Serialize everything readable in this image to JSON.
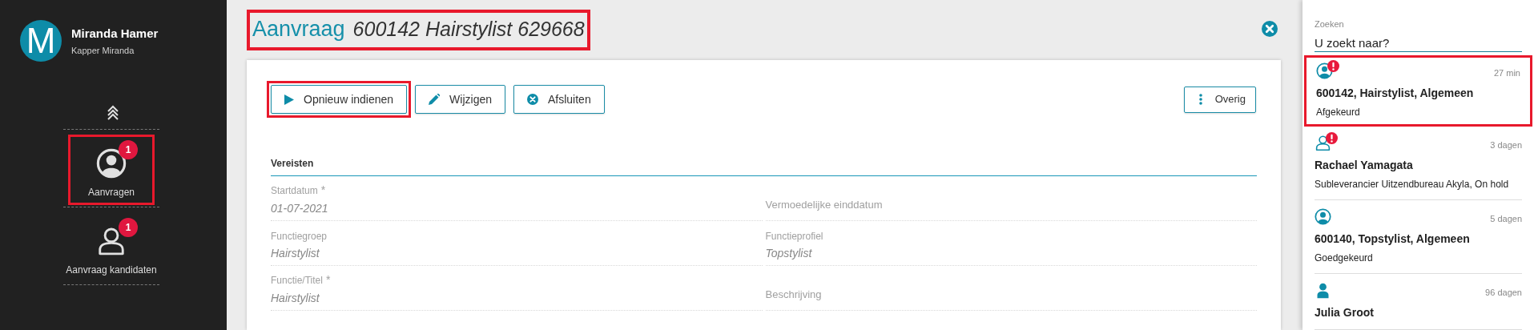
{
  "user": {
    "initial": "M",
    "name": "Miranda Hamer",
    "subtitle": "Kapper Miranda"
  },
  "nav": [
    {
      "label": "Aanvragen",
      "badge": "1",
      "kind": "circle",
      "highlighted": true
    },
    {
      "label": "Aanvraag kandidaten",
      "badge": "1",
      "kind": "outline",
      "highlighted": false
    }
  ],
  "header": {
    "label": "Aanvraag",
    "title": "600142 Hairstylist 629668",
    "highlighted": true
  },
  "toolbar": [
    {
      "label": "Opnieuw indienen",
      "kind": "play",
      "highlighted": true
    },
    {
      "label": "Wijzigen",
      "kind": "pencil",
      "highlighted": false
    },
    {
      "label": "Afsluiten",
      "kind": "close",
      "highlighted": false
    }
  ],
  "more_button": {
    "label": "Overig"
  },
  "section": {
    "title": "Vereisten",
    "fields": [
      {
        "label": "Startdatum",
        "required_mark": "*",
        "value": "01-07-2021"
      },
      {
        "label": "Vermoedelijke einddatum"
      },
      {
        "label": "Functiegroep",
        "value": "Hairstylist"
      },
      {
        "label": "Functieprofiel",
        "value": "Topstylist"
      },
      {
        "label": "Functie/Titel",
        "required_mark": "*",
        "value": "Hairstylist"
      },
      {
        "label": "Beschrijving"
      }
    ]
  },
  "search": {
    "label": "Zoeken",
    "placeholder": "U zoekt naar?"
  },
  "items": [
    {
      "kind": "circle",
      "alert": true,
      "time": "27 min",
      "title": "600142, Hairstylist, Algemeen",
      "subtitle": "Afgekeurd",
      "highlighted": true
    },
    {
      "kind": "outline",
      "alert": true,
      "time": "3 dagen",
      "title": "Rachael Yamagata",
      "subtitle": "Subleverancier Uitzendbureau Akyla, On hold",
      "highlighted": false
    },
    {
      "kind": "circle",
      "alert": false,
      "time": "5 dagen",
      "title": "600140, Topstylist, Algemeen",
      "subtitle": "Goedgekeurd",
      "highlighted": false
    },
    {
      "kind": "solid",
      "alert": false,
      "time": "96 dagen",
      "title": "Julia Groot",
      "highlighted": false
    }
  ]
}
